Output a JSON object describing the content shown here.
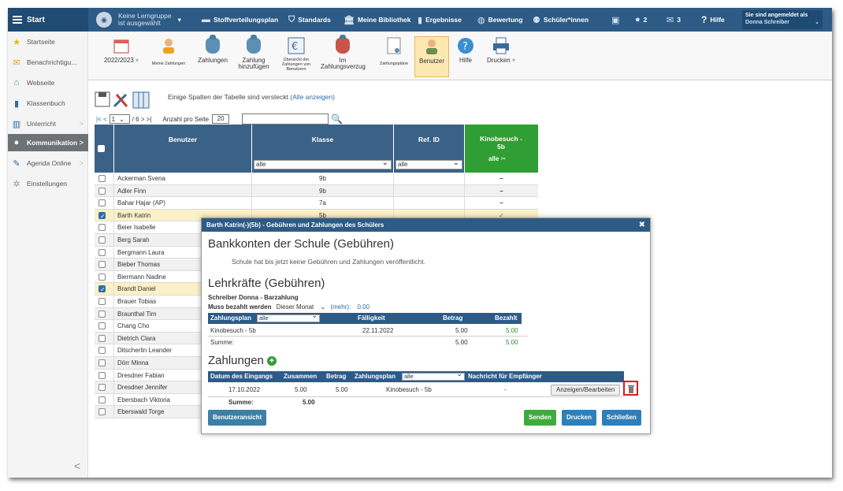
{
  "topbar": {
    "start": "Start",
    "lerngruppe_line1": "Keine Lerngruppe",
    "lerngruppe_line2": "ist ausgewählt",
    "items": [
      "Stoffverteilungsplan",
      "Standards",
      "Meine Bibliothek",
      "Ergebnisse",
      "Bewertung",
      "Schüler*innen"
    ],
    "chat_count": "2",
    "mail_count": "3",
    "help": "Hilfe",
    "user_line1": "Sie sind angemeldet als",
    "user_line2": "Donna Schreiber"
  },
  "sidebar": {
    "items": [
      "Startseite",
      "Benachrichtigu...",
      "Webseite",
      "Klassenbuch",
      "Unterricht",
      "Kommunikation",
      "Agenda Online",
      "Einstellungen"
    ],
    "collapse": "<"
  },
  "ribbon": {
    "year": "2022/2023",
    "items": [
      "Meine Zahlungen",
      "Zahlungen",
      "Zahlung hinzufügen",
      "Übersicht der Zahlungen von Benutzern",
      "Im Zahlungsverzug",
      "Zahlungspläne",
      "Benutzer",
      "Hilfe",
      "Drucken"
    ]
  },
  "content": {
    "hidden_note_prefix": "Einige Spalten der Tabelle sind versteckt ",
    "hidden_note_link": "(Alle anzeigen)",
    "pager_nav_first": "|< <",
    "page_value": "1",
    "pager_of": "/ 6 > >|",
    "per_page_label": "Anzahl pro Seite",
    "per_page_value": "20",
    "columns": {
      "benutzer": "Benutzer",
      "klasse": "Klasse",
      "refid": "Ref. ID",
      "kino": "Kinobesuch - 5b",
      "klasse_filter": "alle",
      "refid_filter": "alle",
      "kino_filter": "alle"
    },
    "rows": [
      {
        "name": "Ackerman Svena",
        "klasse": "9b",
        "kino": "–",
        "checked": false
      },
      {
        "name": "Adler Finn",
        "klasse": "9b",
        "kino": "–",
        "checked": false
      },
      {
        "name": "Bahar Hajar (AP)",
        "klasse": "7a",
        "kino": "–",
        "checked": false
      },
      {
        "name": "Barth Katrin",
        "klasse": "5b",
        "kino": "✓",
        "checked": true
      },
      {
        "name": "Beier Isabelle",
        "klasse": "",
        "kino": "",
        "checked": false
      },
      {
        "name": "Berg Sarah",
        "klasse": "",
        "kino": "",
        "checked": false
      },
      {
        "name": "Bergmann Laura",
        "klasse": "",
        "kino": "",
        "checked": false
      },
      {
        "name": "Bieber Thomas",
        "klasse": "",
        "kino": "",
        "checked": false
      },
      {
        "name": "Biermann Nadine",
        "klasse": "",
        "kino": "",
        "checked": false
      },
      {
        "name": "Brandt Daniel",
        "klasse": "",
        "kino": "",
        "checked": true
      },
      {
        "name": "Brauer Tobias",
        "klasse": "",
        "kino": "",
        "checked": false
      },
      {
        "name": "Braunthal Tim",
        "klasse": "",
        "kino": "",
        "checked": false
      },
      {
        "name": "Chang Cho",
        "klasse": "",
        "kino": "",
        "checked": false
      },
      {
        "name": "Dietrich Clara",
        "klasse": "",
        "kino": "",
        "checked": false
      },
      {
        "name": "Ditscherlin Leander",
        "klasse": "",
        "kino": "",
        "checked": false
      },
      {
        "name": "Dörr Minna",
        "klasse": "",
        "kino": "",
        "checked": false
      },
      {
        "name": "Dresdner Fabian",
        "klasse": "",
        "kino": "",
        "checked": false
      },
      {
        "name": "Dresdner Jennifer",
        "klasse": "",
        "kino": "",
        "checked": false
      },
      {
        "name": "Ebersbach Viktoria",
        "klasse": "",
        "kino": "",
        "checked": false
      },
      {
        "name": "Eberswald Torge",
        "klasse": "",
        "kino": "",
        "checked": false
      }
    ]
  },
  "modal": {
    "title": "Barth Katrin(-)(5b) - Gebühren und Zahlungen des Schülers",
    "close": "✖",
    "section1_title": "Bankkonten der Schule (Gebühren)",
    "section1_text": "Schule hat bis jetzt keine Gebühren und Zahlungen veröffentlicht.",
    "section2_title": "Lehrkräfte (Gebühren)",
    "teacher_line": "Schreiber Donna - Barzahlung",
    "due_label": "Muss bezahlt werden",
    "due_value": "Dieser Monat",
    "more_link": "(mehr):",
    "more_amount": "0.00",
    "fee_head": {
      "plan": "Zahlungsplan",
      "plan_filter": "alle",
      "due": "Fälligkeit",
      "amount": "Betrag",
      "paid": "Bezahlt"
    },
    "fee_row": {
      "name": "Kinobesuch - 5b",
      "due": "22.11.2022",
      "amount": "5.00",
      "paid": "5.00"
    },
    "fee_sum": {
      "label": "Summe:",
      "amount": "5.00",
      "paid": "5.00"
    },
    "section3_title": "Zahlungen",
    "pay_head": {
      "date": "Datum des Eingangs",
      "total": "Zusammen",
      "amount": "Betrag",
      "plan": "Zahlungsplan",
      "plan_filter": "alle",
      "message": "Nachricht für Empfänger"
    },
    "pay_row": {
      "date": "17.10.2022",
      "total": "5.00",
      "amount": "5.00",
      "plan": "Kinobesuch - 5b",
      "message": "-",
      "edit": "Anzeigen/Bearbeiten"
    },
    "pay_sum": {
      "label": "Summe:",
      "amount": "5.00"
    },
    "btn_user_view": "Benutzeransicht",
    "btn_send": "Senden",
    "btn_print": "Drucken",
    "btn_close": "Schließen"
  }
}
